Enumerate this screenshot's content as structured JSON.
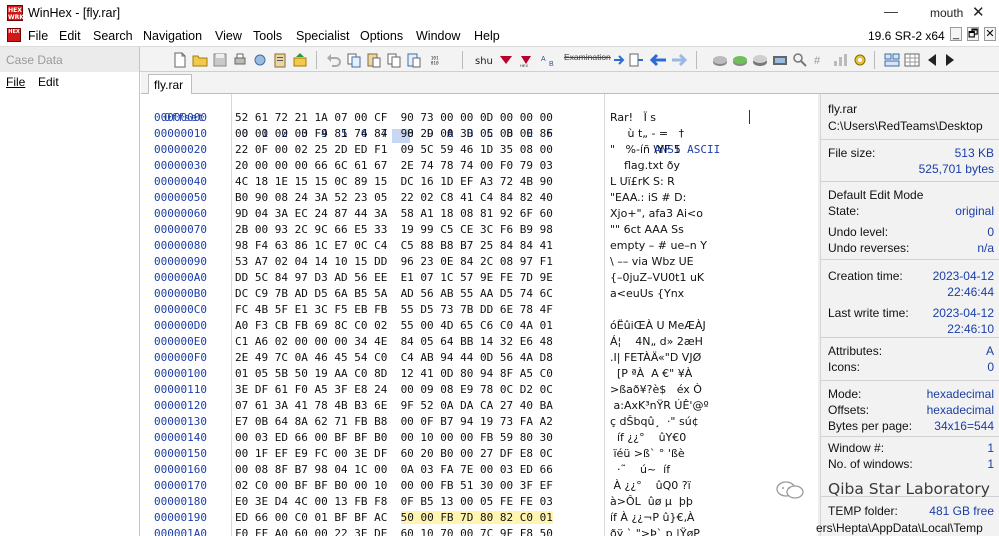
{
  "window": {
    "app_icon_text": "HEX\nWORKS",
    "title": "WinHex - [fly.rar]",
    "minimize": "—",
    "user": "mouth",
    "close": "✕"
  },
  "menu": {
    "items": [
      "File",
      "Edit",
      "Search",
      "Navigation",
      "View",
      "Tools",
      "Specialist",
      "Options",
      "Window",
      "Help"
    ],
    "version": "19.6 SR-2 x64",
    "mdi": [
      "_",
      "🗗",
      "✕"
    ]
  },
  "toolbar": {
    "case_data_label": "Case Data",
    "examination_label": "Examination"
  },
  "left_panel": {
    "file_label": "File",
    "edit_label": "Edit"
  },
  "tab": {
    "label": "fly.rar"
  },
  "hex": {
    "offset_header": "Offset",
    "column_headers": [
      "0",
      "1",
      "2",
      "3",
      "4",
      "5",
      "6",
      "7",
      "8",
      "9",
      "A",
      "B",
      "C",
      "D",
      "E",
      "F"
    ],
    "ascii_header": "ANSI ASCII",
    "rows": [
      {
        "offset": "00000000",
        "bytes": "52 61 72 21 1A 07 00 CF  90 73 00 00 0D 00 00 00",
        "ascii": "Rar!   Ï s"
      },
      {
        "offset": "00000010",
        "bytes": "00 00 00 00 F9 81 74 84  90 2D 00 3D 05 08 00 86",
        "ascii": "     ù t„ - =   †"
      },
      {
        "offset": "00000020",
        "bytes": "22 0F 00 02 25 2D ED F1  09 5C 59 46 1D 35 08 00",
        "ascii": "\"   %-íñ \\YF 5"
      },
      {
        "offset": "00000030",
        "bytes": "20 00 00 00 66 6C 61 67  2E 74 78 74 00 F0 79 03",
        "ascii": "    flag.txt ðy"
      },
      {
        "offset": "00000040",
        "bytes": "4C 18 1E 15 15 0C 89 15  DC 16 1D EF A3 72 4B 90",
        "ascii": "L Uï£rK S: R"
      },
      {
        "offset": "00000050",
        "bytes": "B0 90 08 24 3A 52 23 05  22 02 C8 41 C4 84 82 40",
        "ascii": "\"EAA.: iS # D:"
      },
      {
        "offset": "00000060",
        "bytes": "9D 04 3A EC 24 87 44 3A  58 A1 18 08 81 92 6F 60",
        "ascii": "Xjo+\", afa3 Ai<o"
      },
      {
        "offset": "00000070",
        "bytes": "2B 00 93 2C 9C 66 E5 33  19 99 C5 CE 3C F6 B9 98",
        "ascii": "\"\" 6ct AAA Ss"
      },
      {
        "offset": "00000080",
        "bytes": "98 F4 63 86 1C E7 0C C4  C5 88 B8 B7 25 84 84 41",
        "ascii": "empty – # ue–n Y"
      },
      {
        "offset": "00000090",
        "bytes": "53 A7 02 04 14 10 15 DD  96 23 0E 84 2C 08 97 F1",
        "ascii": "\\ –– via Wbz UE"
      },
      {
        "offset": "000000A0",
        "bytes": "DD 5C 84 97 D3 AD 56 EE  E1 07 1C 57 9E FE 7D 9E",
        "ascii": "{–0juZ–VU0t1 uK"
      },
      {
        "offset": "000000B0",
        "bytes": "DC C9 7B AD D5 6A B5 5A  AD 56 AB 55 AA D5 74 6C",
        "ascii": "a<euUs {Ynx"
      },
      {
        "offset": "000000C0",
        "bytes": "FC 4B 5F E1 3C F5 EB FB  55 D5 73 7B DD 6E 78 4F",
        "ascii": ""
      },
      {
        "offset": "000000D0",
        "bytes": "A0 F3 CB FB 69 8C C0 02  55 00 4D 65 C6 C0 4A 01",
        "ascii": "óËûiŒÀ U MeÆÀJ"
      },
      {
        "offset": "000000E0",
        "bytes": "C1 A6 02 00 00 00 34 4E  84 05 64 BB 14 32 E6 48",
        "ascii": "Á¦    4N„ d» 2æH"
      },
      {
        "offset": "000000F0",
        "bytes": "2E 49 7C 0A 46 45 54 C0  C4 AB 94 44 0D 56 4A D8",
        "ascii": ".I| FETÀÄ«\"D VJØ"
      },
      {
        "offset": "00000100",
        "bytes": "01 05 5B 50 19 AA C0 8D  12 41 0D 80 94 8F A5 C0",
        "ascii": "  [P ªÀ  A €\" ¥À"
      },
      {
        "offset": "00000110",
        "bytes": "3E DF 61 F0 A5 3F E8 24  00 09 08 E9 78 0C D2 0C",
        "ascii": ">ßað¥?è$   éx Ò"
      },
      {
        "offset": "00000120",
        "bytes": "07 61 3A 41 78 4B B3 6E  9F 52 0A DA CA 27 40 BA",
        "ascii": " a:AxK³nŸR ÚÊ'@º"
      },
      {
        "offset": "00000130",
        "bytes": "E7 0B 64 8A 62 71 FB B8  00 0F B7 94 19 73 FA A2",
        "ascii": "ç dŠbqû¸  ·\" sú¢"
      },
      {
        "offset": "00000140",
        "bytes": "00 03 ED 66 00 BF BF B0  00 10 00 00 FB 59 80 30",
        "ascii": "  íf ¿¿°    ûY€0"
      },
      {
        "offset": "00000150",
        "bytes": "00 1F EF E9 FC 00 3E DF  60 20 B0 00 27 DF E8 0C",
        "ascii": " ïéü >ß` ° 'ßè"
      },
      {
        "offset": "00000160",
        "bytes": "00 08 8F B7 98 04 1C 00  0A 03 FA 7E 00 03 ED 66",
        "ascii": "  ·˜    ú~  íf"
      },
      {
        "offset": "00000170",
        "bytes": "02 C0 00 BF BF B0 00 10  00 00 FB 51 30 00 3F EF",
        "ascii": " À ¿¿°    ûQ0 ?ï"
      },
      {
        "offset": "00000180",
        "bytes": "E0 3E D4 4C 00 13 FB F8  0F B5 13 00 05 FE FE 03",
        "ascii": "à>ÔL  ûø µ  þþ"
      },
      {
        "offset": "00000190",
        "bytes": "ED 66 00 C0 01 BF BF AC  50 00 FB 7D 80 82 C0 01",
        "ascii": "íf À ¿¿¬P û}€‚À"
      },
      {
        "offset": "000001A0",
        "bytes": "F0 FF A0 60 00 22 3E DE  60 10 70 00 7C 9F F8 50",
        "ascii": "ðÿ ` \">Þ` p |ŸøP"
      }
    ]
  },
  "info": {
    "filename": "fly.rar",
    "path": "C:\\Users\\RedTeams\\Desktop",
    "file_size_label": "File size:",
    "file_size_kb": "513 KB",
    "file_size_bytes": "525,701 bytes",
    "default_edit_mode_label": "Default Edit Mode",
    "state_label": "State:",
    "state_value": "original",
    "undo_level_label": "Undo level:",
    "undo_level_value": "0",
    "undo_reverses_label": "Undo reverses:",
    "undo_reverses_value": "n/a",
    "creation_time_label": "Creation time:",
    "creation_date": "2023-04-12",
    "creation_clock": "22:46:44",
    "last_write_label": "Last write time:",
    "last_write_date": "2023-04-12",
    "last_write_clock": "22:46:10",
    "attributes_label": "Attributes:",
    "attributes_value": "A",
    "icons_label": "Icons:",
    "icons_value": "0",
    "mode_label": "Mode:",
    "mode_value": "hexadecimal",
    "offsets_label": "Offsets:",
    "offsets_value": "hexadecimal",
    "bytes_per_page_label": "Bytes per page:",
    "bytes_per_page_value": "34x16=544",
    "window_no_label": "Window #:",
    "window_no_value": "1",
    "no_windows_label": "No. of windows:",
    "no_windows_value": "1",
    "temp_folder_label": "TEMP folder:",
    "temp_free": "481 GB free",
    "temp_path": "ers\\Hepta\\AppData\\Local\\Temp"
  },
  "watermark": {
    "text": "Qiba Star Laboratory"
  },
  "colors": {
    "offset_blue": "#1a3ea8",
    "app_red": "#d01818",
    "selection": "#fff4b0"
  }
}
